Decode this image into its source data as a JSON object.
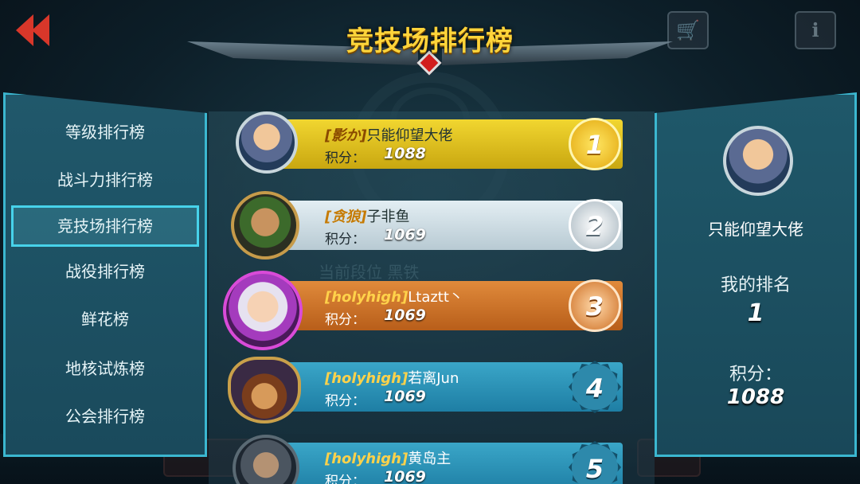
{
  "header": {
    "title": "竞技场排行榜",
    "back_icon": "double-chevron-left-icon",
    "shop_icon": "cart-icon",
    "info_icon": "info-icon"
  },
  "background": {
    "watermark": "当前段位 黑铁"
  },
  "sidebar": {
    "items": [
      {
        "label": "等级排行榜",
        "active": false
      },
      {
        "label": "战斗力排行榜",
        "active": false
      },
      {
        "label": "竞技场排行榜",
        "active": true
      },
      {
        "label": "战役排行榜",
        "active": false
      },
      {
        "label": "鲜花榜",
        "active": false
      },
      {
        "label": "地核试炼榜",
        "active": false
      },
      {
        "label": "公会排行榜",
        "active": false
      }
    ]
  },
  "ranking": {
    "score_label": "积分：",
    "rows": [
      {
        "rank": "1",
        "guild": "[影か]",
        "player": "只能仰望大佬",
        "score": "1088",
        "style": "gold"
      },
      {
        "rank": "2",
        "guild": "[贪狼]",
        "player": "子非鱼",
        "score": "1069",
        "style": "silver"
      },
      {
        "rank": "3",
        "guild": "[holyhigh]",
        "player": "Ltaztt丶",
        "score": "1069",
        "style": "bronze"
      },
      {
        "rank": "4",
        "guild": "[holyhigh]",
        "player": "若离Jun",
        "score": "1069",
        "style": "blue"
      },
      {
        "rank": "5",
        "guild": "[holyhigh]",
        "player": "黄岛主",
        "score": "1069",
        "style": "blue"
      }
    ]
  },
  "my_info": {
    "name": "只能仰望大佬",
    "rank_label": "我的排名",
    "rank_value": "1",
    "score_label": "积分：",
    "score_value": "1088"
  },
  "colors": {
    "title": "#ffd43a",
    "panel_border": "#3bb7d0",
    "gold_row": "#e3c420",
    "silver_row": "#d2e0e7",
    "bronze_row": "#cf7430",
    "blue_row": "#2b93b9"
  }
}
